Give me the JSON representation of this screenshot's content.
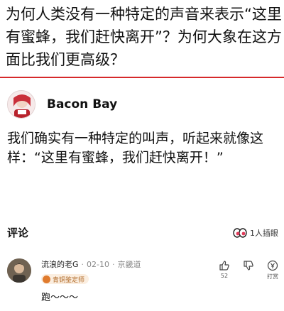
{
  "question": {
    "title": "为何人类没有一种特定的声音来表示“这里有蜜蜂，我们赶快离开”？为何大象在这方面比我们更高级？"
  },
  "answer": {
    "author": "Bacon Bay",
    "body": "我们确实有一种特定的叫声，听起来就像这样：“这里有蜜蜂，我们赶快离开！”"
  },
  "comments": {
    "title": "评论",
    "viewers": "1人插眼",
    "items": [
      {
        "username": "流浪的老G",
        "date": "02-10",
        "location": "京畿道",
        "badge": "青铜鉴定师",
        "text": "跑～～～",
        "likes": "52",
        "tip_label": "打赏"
      }
    ]
  },
  "colors": {
    "accent": "#d6292b",
    "badge": "#e07b2d"
  }
}
